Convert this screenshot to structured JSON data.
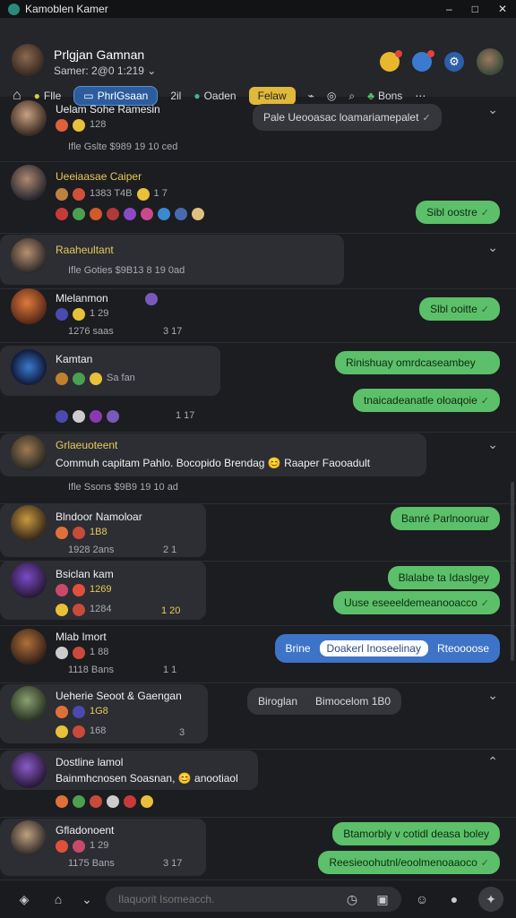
{
  "app": {
    "title": "Kamoblen Kamer"
  },
  "window": {
    "min": "–",
    "max": "□",
    "close": "✕"
  },
  "header": {
    "name": "Prlgjan Gamnan",
    "status": "Samer: 2@0 1:219",
    "status_chevron": "⌄"
  },
  "tabs": [
    {
      "label": "Flle"
    },
    {
      "label": "PhrlGsaan",
      "badge": "2il"
    },
    {
      "label": "Oaden"
    },
    {
      "label": "Felaw"
    },
    {
      "label": ""
    },
    {
      "label": "Bons"
    }
  ],
  "rows": [
    {
      "name": "Uelam Sohe Ramesin",
      "reactions": "128",
      "meta": "Ifle   Gslte      $989 19 10 ced",
      "out": "Pale Ueooasac loamariamepalet"
    },
    {
      "name": "Ueeiaasae Caiper",
      "reactions": "1383  T4B",
      "meta": "1 7",
      "out": "Sibl oostre"
    },
    {
      "name": "Raaheultant",
      "meta": "Ifle   Goties    $9B13 8 19 0ad"
    },
    {
      "name": "Mlelanmon",
      "reactions": "1 29",
      "meta": "1276  saas",
      "meta2": "3 17",
      "out": "Slbl ooitte"
    },
    {
      "name": "Kamtan",
      "reactions": "Sa   fan",
      "meta": "1 17",
      "out1": "Rinishuay omrdcaseambey",
      "out2": "tnaicadeanatle oloaqoie"
    },
    {
      "name": "Grlaeuoteent",
      "text": "Commuh capitam  Pahlo. Bocopido Brendag 😊 Raaper Faooadult",
      "meta": "Ifle   Ssons    $9B9 19 10 ad"
    },
    {
      "name": "Blndoor Namoloar",
      "reactions": "1B8",
      "meta": "1928  2ans",
      "meta2": "2 1",
      "out": "Banré Parlnooruar"
    },
    {
      "name": "Bsiclan kam",
      "reactions": "1269",
      "meta": "1284",
      "meta2": "1 20",
      "out1": "Blalabe ta Idaslgey",
      "out2": "Uuse eseeeldemeanooacco"
    },
    {
      "name": "Mlab Imort",
      "reactions": "1 88",
      "meta": "1118  Bans",
      "meta2": "1 1",
      "pill": [
        "Brine",
        "Doakerl Inoseelinay",
        "Rteoooose"
      ]
    },
    {
      "name": "Ueherie Seoot & Gaengan",
      "reactions": "1G8",
      "meta": "168",
      "meta2": "3",
      "pill2": [
        "Biroglan",
        "Bimocelom 1B0"
      ]
    },
    {
      "name": "Dostline lamol",
      "text": "Bainmhcnosen Soasnan, 😊 anootiaol",
      "meta": ""
    },
    {
      "name": "Gfladonoent",
      "reactions": "1 29",
      "meta": "1175  Bans",
      "meta2": "3 17",
      "out1": "Btamorbly v cotidl deasa boley",
      "out2": "Reesieoohutnl/eoolmenoaaoco"
    }
  ],
  "composer": {
    "placeholder": "Ilaquorit Isomeacch."
  },
  "colors": {
    "accent": "#3e74c8",
    "outgoing": "#5cc06a",
    "background": "#1c1d20"
  }
}
